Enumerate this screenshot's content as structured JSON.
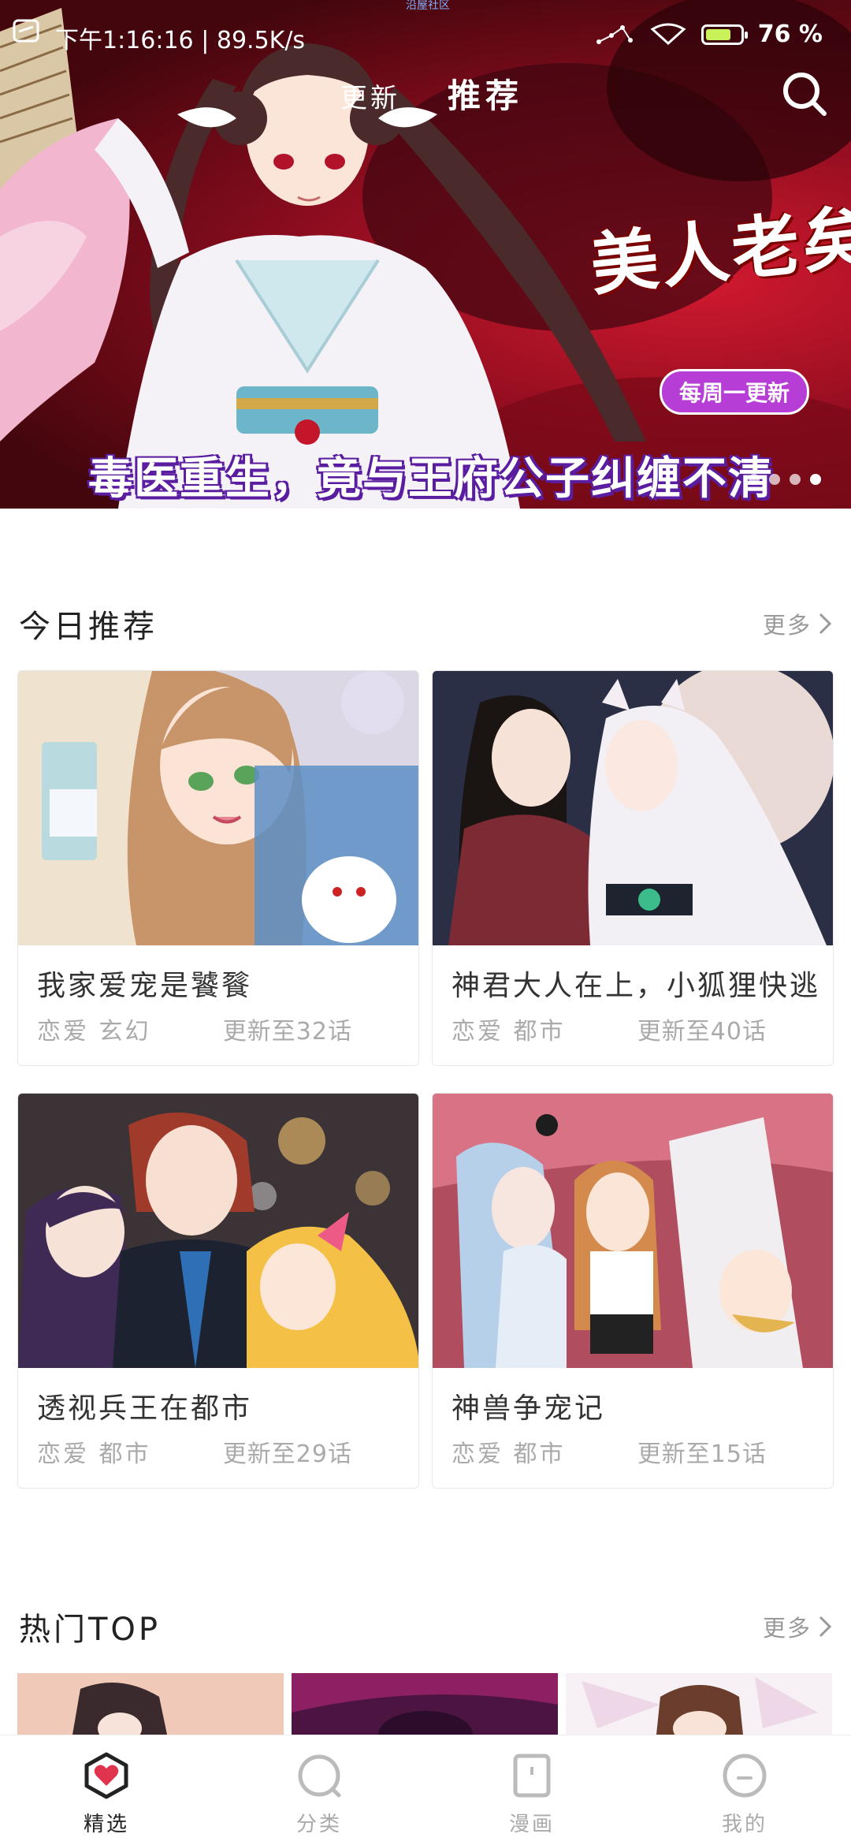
{
  "status_bar": {
    "time": "下午1:16:16",
    "net_speed": "89.5K/s",
    "top_mini_text": "沿屋社区",
    "battery_percent": "76",
    "battery_level": 0.76
  },
  "header": {
    "tabs": [
      {
        "label": "更新",
        "active": false
      },
      {
        "label": "推荐",
        "active": true
      }
    ],
    "search_icon": "search-icon"
  },
  "banner": {
    "title_art": "美人老矣",
    "badge": "每周一更新",
    "caption": "毒医重生，竟与王府公子纠缠不清",
    "dots_count": 4,
    "active_dot": 3
  },
  "recommend": {
    "title": "今日推荐",
    "more": "更多",
    "items": [
      {
        "title": "我家爱宠是饕餮",
        "tags": "恋爱 玄幻",
        "update": "更新至32话"
      },
      {
        "title": "神君大人在上，小狐狸快逃",
        "tags": "恋爱 都市",
        "update": "更新至40话"
      },
      {
        "title": "透视兵王在都市",
        "tags": "恋爱 都市",
        "update": "更新至29话"
      },
      {
        "title": "神兽争宠记",
        "tags": "恋爱 都市",
        "update": "更新至15话"
      }
    ]
  },
  "hot": {
    "title": "热门TOP",
    "more": "更多"
  },
  "bottom_nav": {
    "items": [
      {
        "label": "精选",
        "icon": "heart-badge-icon",
        "active": true
      },
      {
        "label": "分类",
        "icon": "circle-icon",
        "active": false
      },
      {
        "label": "漫画",
        "icon": "book-icon",
        "active": false
      },
      {
        "label": "我的",
        "icon": "profile-icon",
        "active": false
      }
    ]
  },
  "colors": {
    "accent": "#e0334d",
    "badge_purple": "#b63ed6",
    "text_primary": "#333333",
    "text_secondary": "#aaaaaa"
  }
}
